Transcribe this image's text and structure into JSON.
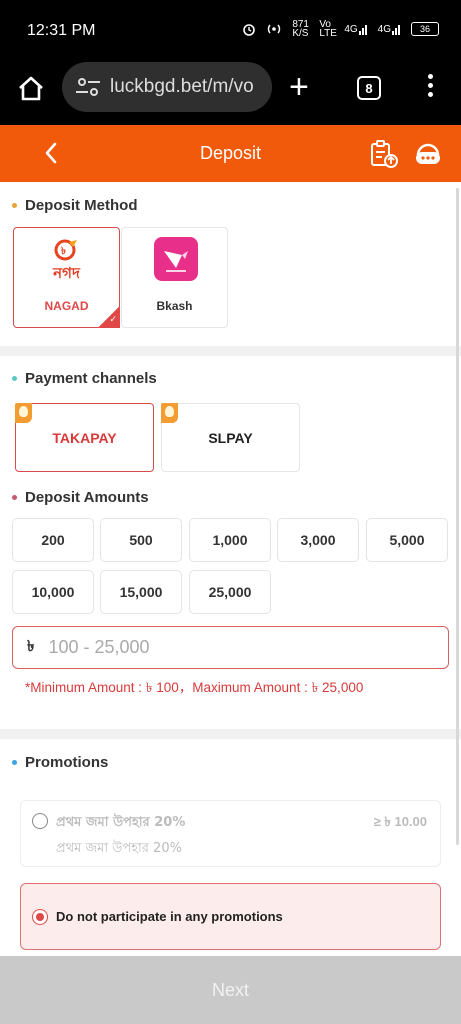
{
  "status_bar": {
    "time": "12:31 PM",
    "net_speed": "871 K/S",
    "volte": "Vo LTE",
    "signal1": "4G",
    "signal2": "4G",
    "battery": "36"
  },
  "browser": {
    "url": "luckbgd.bet/m/vo",
    "tab_count": "8"
  },
  "header": {
    "title": "Deposit"
  },
  "deposit_method": {
    "title": "Deposit Method",
    "methods": [
      {
        "label": "NAGAD",
        "logo_text": "নগদ",
        "selected": true
      },
      {
        "label": "Bkash",
        "selected": false
      }
    ]
  },
  "payment_channels": {
    "title": "Payment channels",
    "channels": [
      {
        "label": "TAKAPAY",
        "selected": true
      },
      {
        "label": "SLPAY",
        "selected": false
      }
    ]
  },
  "deposit_amounts": {
    "title": "Deposit Amounts",
    "row1": [
      "200",
      "500",
      "1,000",
      "3,000",
      "5,000"
    ],
    "row2": [
      "10,000",
      "15,000",
      "25,000"
    ],
    "currency": "৳",
    "placeholder": "100 - 25,000",
    "limit_text": "*Minimum Amount : ৳ 100，Maximum Amount : ৳ 25,000"
  },
  "promotions": {
    "title": "Promotions",
    "offer": {
      "title": "প্রথম জমা উপহার 20%",
      "subtitle": "প্রথম জমা উপহার 20%",
      "min_amount": "≥ ৳ 10.00"
    },
    "none_label": "Do not participate in any promotions"
  },
  "footer": {
    "next_label": "Next"
  },
  "colors": {
    "brand": "#f15a0a",
    "selected_border": "#d94b4b",
    "error": "#d93a3a"
  }
}
